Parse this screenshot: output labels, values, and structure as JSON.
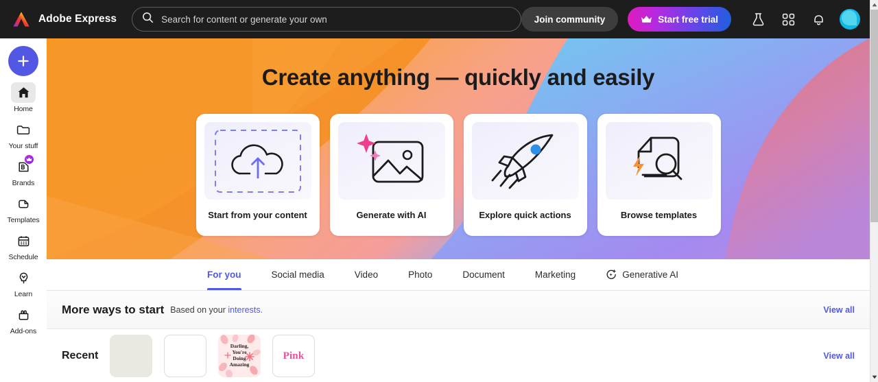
{
  "header": {
    "brand": "Adobe Express",
    "logo_icon": "adobe-logo",
    "search": {
      "icon": "search-icon",
      "placeholder": "Search for content or generate your own",
      "value": ""
    },
    "join_label": "Join community",
    "trial_label": "Start free trial",
    "trial_icon": "crown-icon",
    "icons": [
      {
        "name": "beaker-icon",
        "title": "Experiments"
      },
      {
        "name": "app-grid-icon",
        "title": "Apps"
      },
      {
        "name": "bell-icon",
        "title": "Notifications"
      }
    ],
    "avatar": "user-avatar",
    "bg_color": "#1d1d1d",
    "trial_gradient": "#e01bbd -> #1f5fe0"
  },
  "sidebar": {
    "create_label": "+",
    "create_color": "#5258e4",
    "items": [
      {
        "label": "Home",
        "icon": "home-icon",
        "active": true
      },
      {
        "label": "Your stuff",
        "icon": "folder-icon",
        "active": false
      },
      {
        "label": "Brands",
        "icon": "brand-b-icon",
        "active": false,
        "badge": "crown-badge-icon"
      },
      {
        "label": "Templates",
        "icon": "templates-icon",
        "active": false
      },
      {
        "label": "Schedule",
        "icon": "calendar-icon",
        "active": false
      },
      {
        "label": "Learn",
        "icon": "lightbulb-icon",
        "active": false
      },
      {
        "label": "Add-ons",
        "icon": "addons-icon",
        "active": false
      }
    ]
  },
  "hero": {
    "title": "Create anything — quickly and easily",
    "cards": [
      {
        "label": "Start from your content",
        "icon": "cloud-upload-icon"
      },
      {
        "label": "Generate with AI",
        "icon": "ai-image-icon"
      },
      {
        "label": "Explore quick actions",
        "icon": "rocket-icon"
      },
      {
        "label": "Browse templates",
        "icon": "document-search-icon"
      }
    ],
    "colors": {
      "orange": "#f58220",
      "peach": "#f7a07a",
      "blue": "#6fc4ee",
      "purple": "#8a80f0",
      "salmon": "#e4767f"
    }
  },
  "tabs": {
    "items": [
      {
        "label": "For you",
        "active": true,
        "icon": null
      },
      {
        "label": "Social media",
        "active": false,
        "icon": null
      },
      {
        "label": "Video",
        "active": false,
        "icon": null
      },
      {
        "label": "Photo",
        "active": false,
        "icon": null
      },
      {
        "label": "Document",
        "active": false,
        "icon": null
      },
      {
        "label": "Marketing",
        "active": false,
        "icon": null
      },
      {
        "label": "Generative AI",
        "active": false,
        "icon": "sparkle-circle-icon"
      }
    ],
    "active_color": "#5258e4"
  },
  "more_ways": {
    "title": "More ways to start",
    "subtitle_prefix": "Based on your ",
    "subtitle_link": "interests.",
    "view_all": "View all"
  },
  "recent": {
    "label": "Recent",
    "view_all": "View all",
    "thumbs": [
      {
        "type": "beige",
        "text": ""
      },
      {
        "type": "blank",
        "text": ""
      },
      {
        "type": "darling",
        "lines": [
          "Darling,",
          "You're",
          "Doing",
          "Amazing"
        ]
      },
      {
        "type": "pink",
        "text": "Pink"
      }
    ]
  },
  "scrollbar": {
    "up_arrow": "scroll-up-arrow",
    "down_arrow": "scroll-down-arrow",
    "thumb": "scrollbar-thumb"
  }
}
